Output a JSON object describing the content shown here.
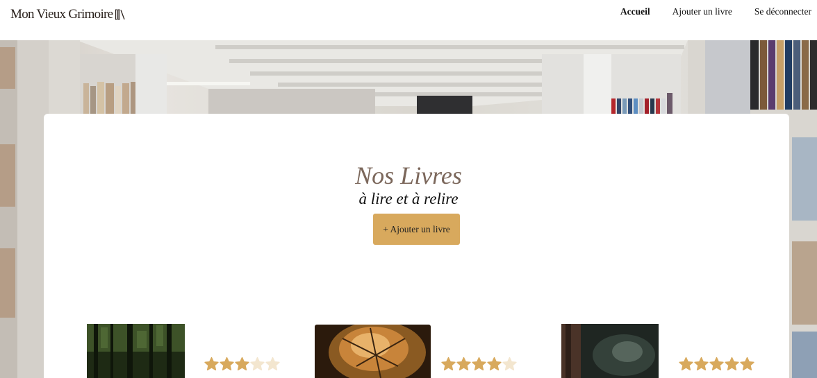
{
  "header": {
    "logo_text": "Mon Vieux Grimoire",
    "nav": [
      {
        "label": "Accueil",
        "active": true
      },
      {
        "label": "Ajouter un livre",
        "active": false
      },
      {
        "label": "Se déconnecter",
        "active": false
      }
    ]
  },
  "hero": {
    "title": "Nos Livres",
    "subtitle": "à lire et à relire",
    "add_button_label": "+ Ajouter un livre"
  },
  "books": [
    {
      "image": "forest-photo",
      "rating": 3
    },
    {
      "image": "autumn-leaf-photo",
      "rating": 4
    },
    {
      "image": "tree-bark-photo",
      "rating": 5
    }
  ],
  "colors": {
    "accent": "#d8a95d",
    "title": "#7b675b",
    "star_filled": "#d8a95d",
    "star_empty": "#f3e6cf"
  }
}
